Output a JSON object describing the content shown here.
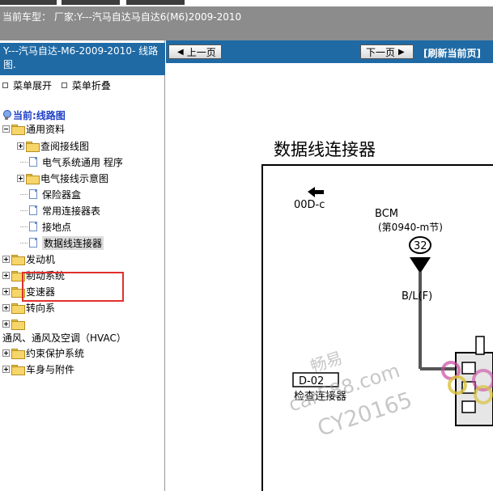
{
  "header": {
    "text": "当前车型：  厂家:Y---汽马自达马自达6(M6)2009-2010"
  },
  "left": {
    "title": "Y---汽马自达-M6-2009-2010- 线路图.",
    "expand_menu": "菜单展开",
    "collapse_menu": "菜单折叠",
    "current": "当前:线路图",
    "tree": [
      {
        "label": "通用资料"
      },
      {
        "label": "查阅接线图"
      },
      {
        "label": "电气系统通用 程序"
      },
      {
        "label": "电气接线示意图"
      },
      {
        "label": "保险器盒"
      },
      {
        "label": "常用连接器表"
      },
      {
        "label": "接地点"
      },
      {
        "label": "数据线连接器"
      },
      {
        "label": "发动机"
      },
      {
        "label": "制动系统"
      },
      {
        "label": "变速器"
      },
      {
        "label": "转向系"
      },
      {
        "label": ""
      },
      {
        "label": "通风、通风及空调（HVAC）"
      },
      {
        "label": "约束保护系统"
      },
      {
        "label": "车身与附件"
      }
    ]
  },
  "nav": {
    "prev_label": "上一页",
    "next_label": "下一页",
    "refresh_label": "[刷新当前页]"
  },
  "diagram": {
    "title": "数据线连接器",
    "ref_code": "00D-c",
    "bcm_label": "BCM",
    "bcm_sub": "(第0940-m节)",
    "pin": "32",
    "wire": "B/L(F)",
    "connector_code": "D-02",
    "connector_name": "检查连接器",
    "watermark_line1": "畅易",
    "watermark_line2": "car588.com",
    "watermark_line3": "CY20165"
  },
  "colors": {
    "header_bg": "#8c8c8c",
    "panel_blue": "#1f6aa5",
    "highlight_red": "#e0302e",
    "current_blue": "#1d3fc5"
  }
}
